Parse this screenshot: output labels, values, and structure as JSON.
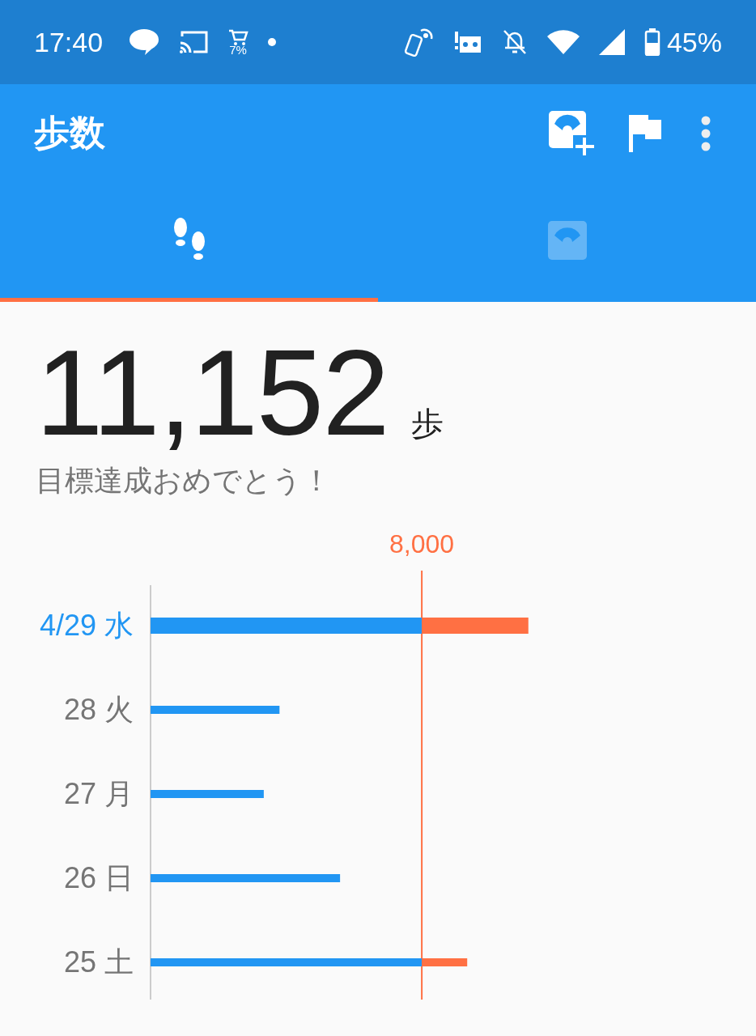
{
  "status_bar": {
    "time": "17:40",
    "cart_percent": "7%",
    "battery": "45%"
  },
  "app_bar": {
    "title": "歩数"
  },
  "tabs": [
    {
      "kind": "steps",
      "selected": true
    },
    {
      "kind": "weight",
      "selected": false
    }
  ],
  "summary": {
    "steps": "11,152",
    "unit": "歩",
    "message": "目標達成おめでとう！"
  },
  "goal": {
    "label": "8,000"
  },
  "days": [
    {
      "label": "4/29 水",
      "selected": true
    },
    {
      "label": "28 火",
      "selected": false
    },
    {
      "label": "27 月",
      "selected": false
    },
    {
      "label": "26 日",
      "selected": false
    },
    {
      "label": "25 土",
      "selected": false
    }
  ]
}
